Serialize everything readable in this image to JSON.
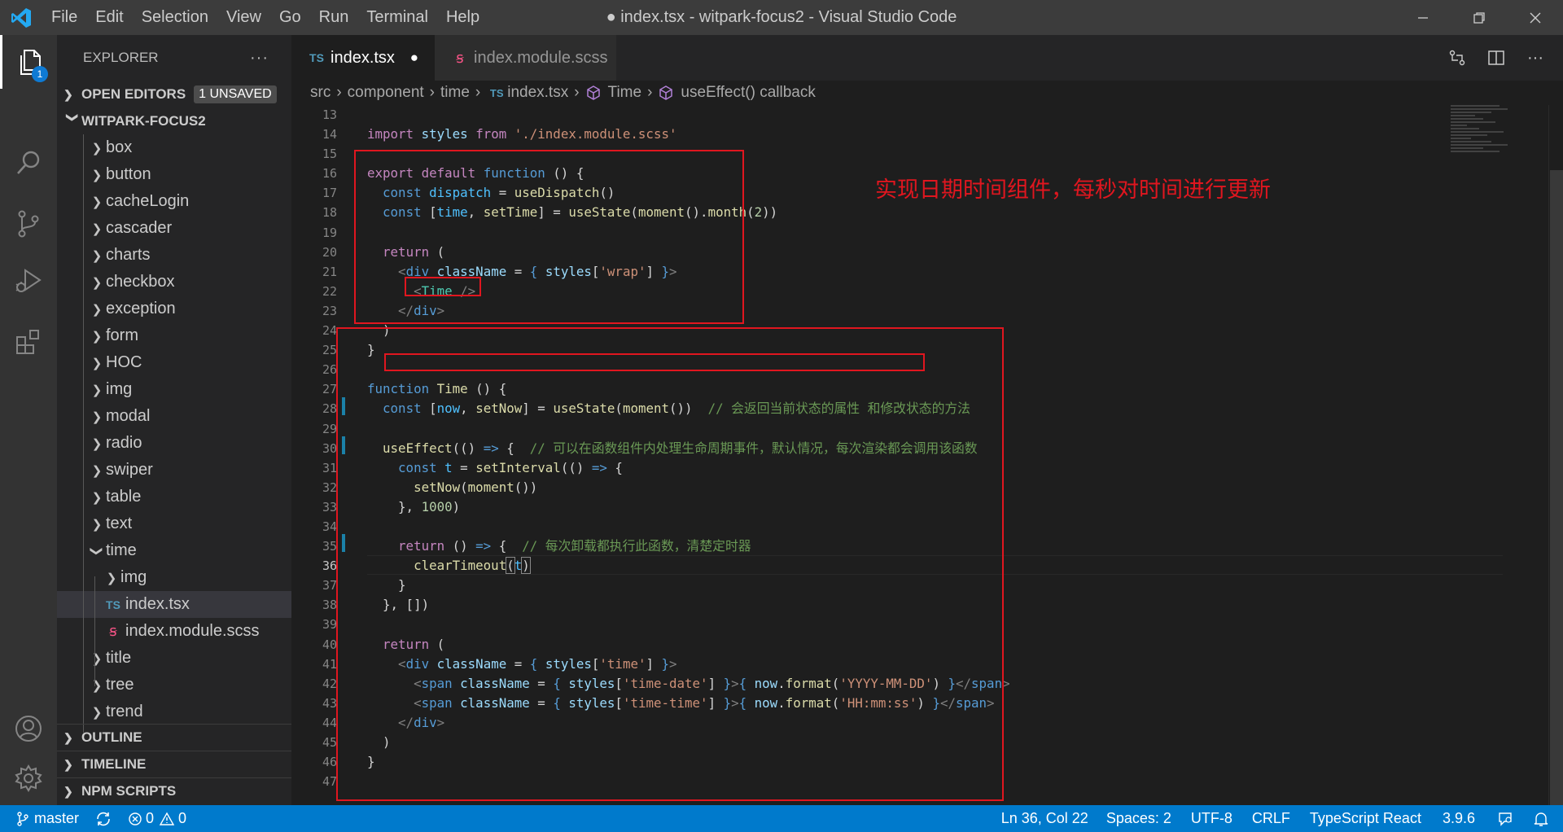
{
  "titlebar": {
    "menu": [
      "File",
      "Edit",
      "Selection",
      "View",
      "Go",
      "Run",
      "Terminal",
      "Help"
    ],
    "window_title": "● index.tsx - witpark-focus2 - Visual Studio Code"
  },
  "activitybar": {
    "explorer_badge": "1"
  },
  "sidebar": {
    "title": "EXPLORER",
    "more": "···",
    "open_editors": "OPEN EDITORS",
    "unsaved": "1 UNSAVED",
    "project": "WITPARK-FOCUS2",
    "folders": [
      "box",
      "button",
      "cacheLogin",
      "cascader",
      "charts",
      "checkbox",
      "exception",
      "form",
      "HOC",
      "img",
      "modal",
      "radio",
      "swiper",
      "table",
      "text",
      "time"
    ],
    "time_children": {
      "img": "img",
      "ts_icon": "TS",
      "index_tsx": "index.tsx",
      "index_scss": "index.module.scss"
    },
    "after": [
      "title",
      "tree",
      "trend"
    ],
    "outline": "OUTLINE",
    "timeline": "TIMELINE",
    "npm_scripts": "NPM SCRIPTS"
  },
  "tabs": {
    "active": {
      "icon": "TS",
      "label": "index.tsx",
      "dirty": "●"
    },
    "inactive": {
      "label": "index.module.scss"
    }
  },
  "breadcrumb": {
    "items": [
      "src",
      "component",
      "time",
      "index.tsx",
      "Time",
      "useEffect() callback"
    ],
    "ts_icon": "TS"
  },
  "editor": {
    "line_numbers": [
      "13",
      "14",
      "15",
      "16",
      "17",
      "18",
      "19",
      "20",
      "21",
      "22",
      "23",
      "24",
      "25",
      "26",
      "27",
      "28",
      "29",
      "30",
      "31",
      "32",
      "33",
      "34",
      "35",
      "36",
      "37",
      "38",
      "39",
      "40",
      "41",
      "42",
      "43",
      "44",
      "45",
      "46",
      "47"
    ],
    "annotation": "实现日期时间组件，每秒对时间进行更新",
    "comments": {
      "c28": "// 会返回当前状态的属性 和修改状态的方法",
      "c30": "// 可以在函数组件内处理生命周期事件，默认情况，每次渲染都会调用该函数",
      "c35": "// 每次卸载都执行此函数，清楚定时器"
    },
    "strings": {
      "import_path": "'./index.module.scss'",
      "wrap": "'wrap'",
      "time": "'time'",
      "time_date": "'time-date'",
      "time_time": "'time-time'",
      "fmt_date": "'YYYY-MM-DD'",
      "fmt_time": "'HH:mm:ss'"
    }
  },
  "statusbar": {
    "branch": "master",
    "errors": "0",
    "warnings": "0",
    "position": "Ln 36, Col 22",
    "spaces": "Spaces: 2",
    "encoding": "UTF-8",
    "eol": "CRLF",
    "language": "TypeScript React",
    "ts_version": "3.9.6"
  }
}
